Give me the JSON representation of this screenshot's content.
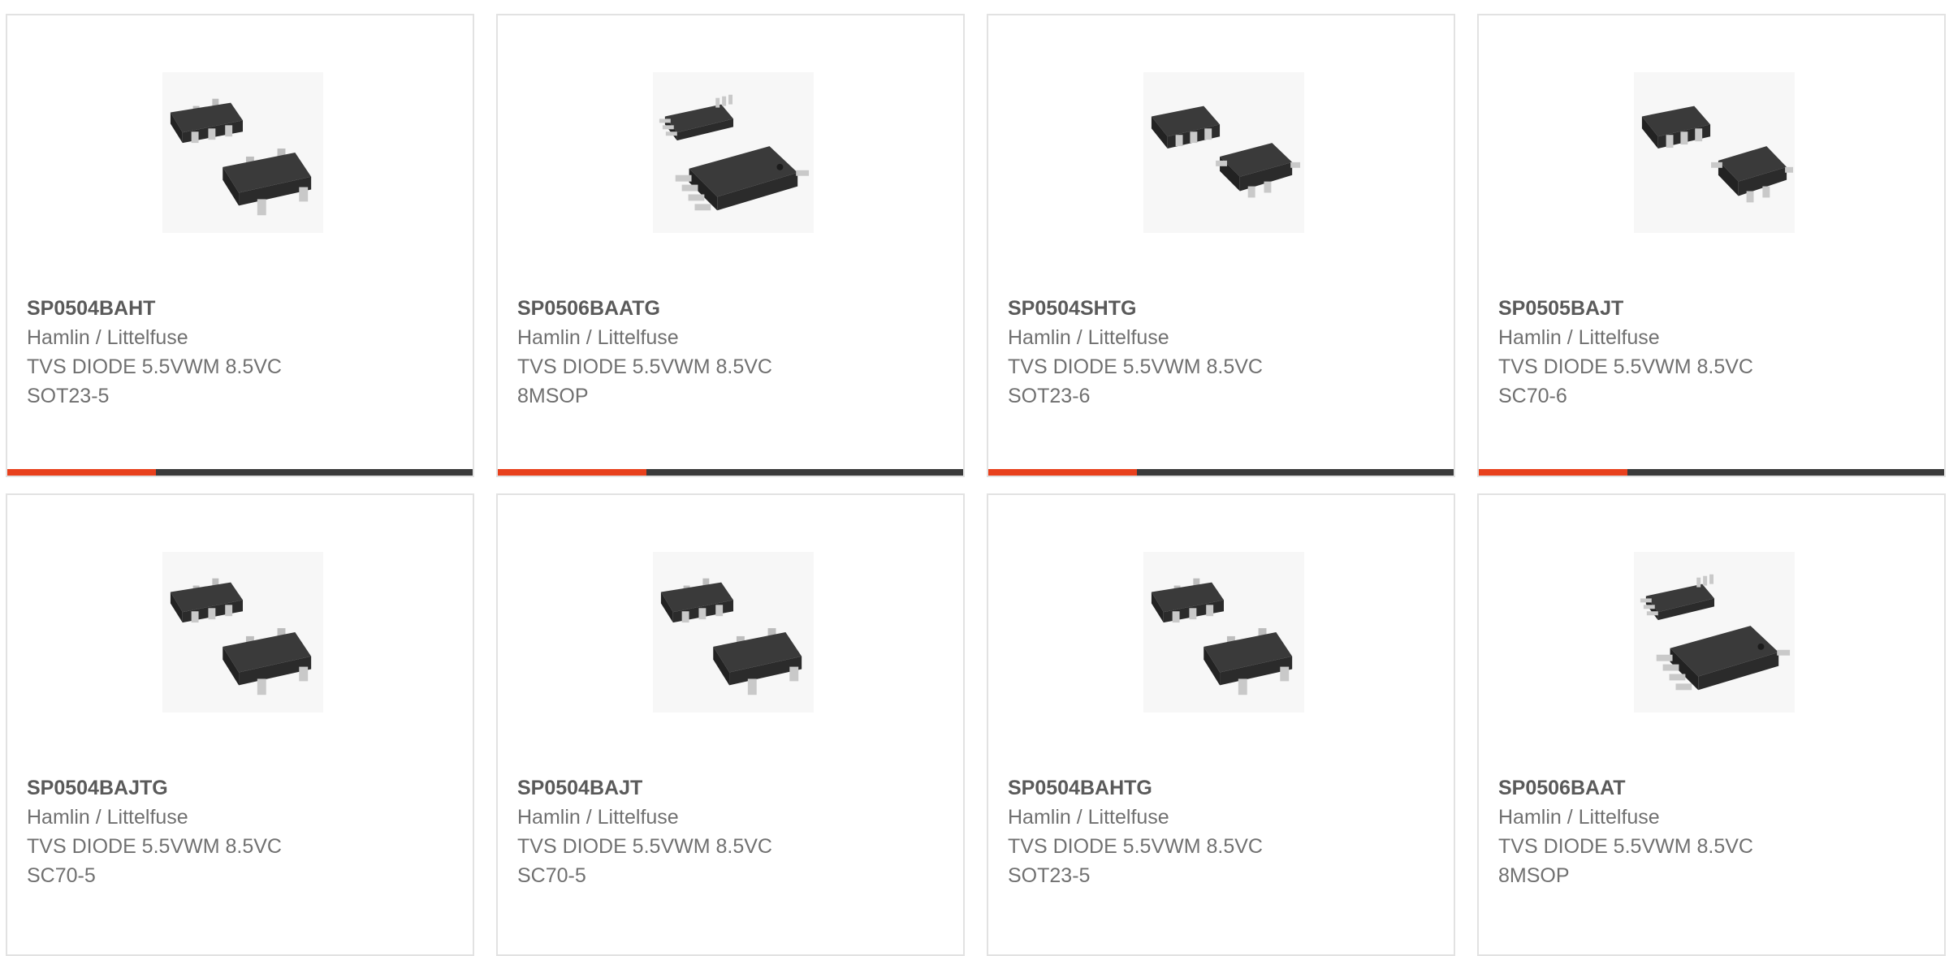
{
  "accent_color": "#e8401c",
  "products": [
    {
      "part_number": "SP0504BAHT",
      "manufacturer": "Hamlin / Littelfuse",
      "description": "TVS DIODE 5.5VWM 8.5VC",
      "package": "SOT23-5",
      "image_icon": "sot23-chip-image"
    },
    {
      "part_number": "SP0506BAATG",
      "manufacturer": "Hamlin / Littelfuse",
      "description": "TVS DIODE 5.5VWM 8.5VC",
      "package": "8MSOP",
      "image_icon": "msop8-chip-image"
    },
    {
      "part_number": "SP0504SHTG",
      "manufacturer": "Hamlin / Littelfuse",
      "description": "TVS DIODE 5.5VWM 8.5VC",
      "package": "SOT23-6",
      "image_icon": "sot23-6-chip-image"
    },
    {
      "part_number": "SP0505BAJT",
      "manufacturer": "Hamlin / Littelfuse",
      "description": "TVS DIODE 5.5VWM 8.5VC",
      "package": "SC70-6",
      "image_icon": "sc70-6-chip-image"
    },
    {
      "part_number": "SP0504BAJTG",
      "manufacturer": "Hamlin / Littelfuse",
      "description": "TVS DIODE 5.5VWM 8.5VC",
      "package": "SC70-5",
      "image_icon": "sot23-chip-image"
    },
    {
      "part_number": "SP0504BAJT",
      "manufacturer": "Hamlin / Littelfuse",
      "description": "TVS DIODE 5.5VWM 8.5VC",
      "package": "SC70-5",
      "image_icon": "sot23-chip-image"
    },
    {
      "part_number": "SP0504BAHTG",
      "manufacturer": "Hamlin / Littelfuse",
      "description": "TVS DIODE 5.5VWM 8.5VC",
      "package": "SOT23-5",
      "image_icon": "sot23-chip-image"
    },
    {
      "part_number": "SP0506BAAT",
      "manufacturer": "Hamlin / Littelfuse",
      "description": "TVS DIODE 5.5VWM 8.5VC",
      "package": "8MSOP",
      "image_icon": "msop8-chip-image"
    }
  ]
}
